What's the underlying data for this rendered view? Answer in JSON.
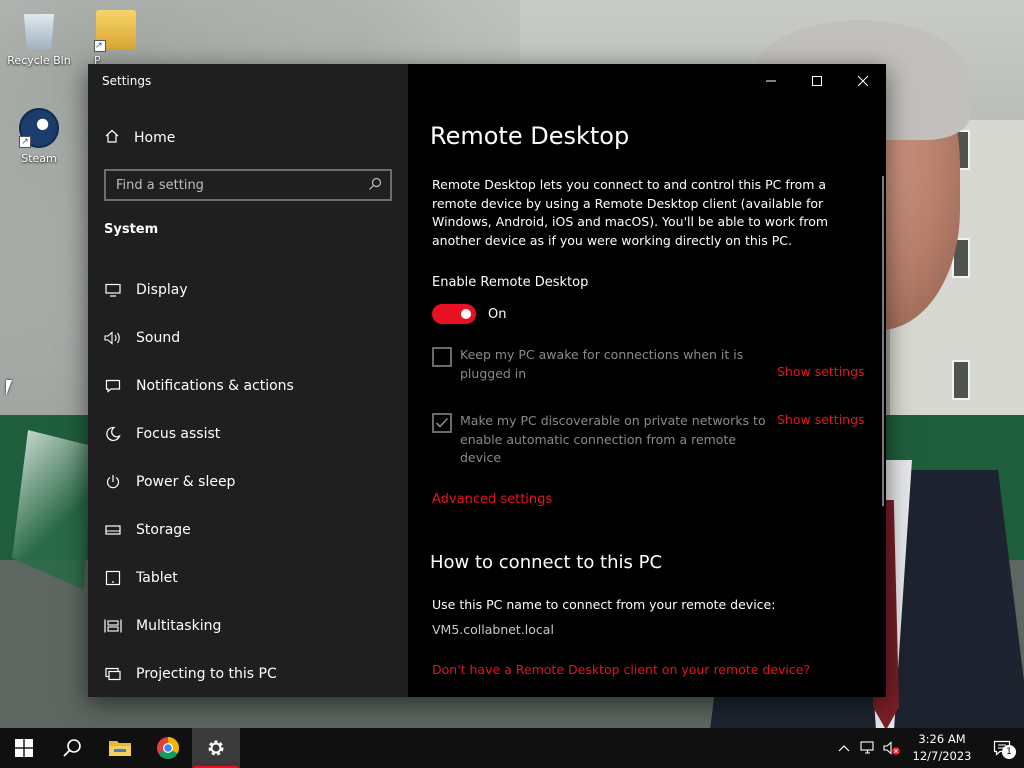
{
  "desktop": {
    "icons": [
      {
        "label": "Recycle Bin"
      },
      {
        "label": "P"
      },
      {
        "label": "Steam"
      }
    ]
  },
  "window": {
    "title": "Settings"
  },
  "sidebar": {
    "home_label": "Home",
    "search_placeholder": "Find a setting",
    "section_title": "System",
    "items": [
      {
        "label": "Display",
        "icon": "display-icon"
      },
      {
        "label": "Sound",
        "icon": "sound-icon"
      },
      {
        "label": "Notifications & actions",
        "icon": "notifications-icon"
      },
      {
        "label": "Focus assist",
        "icon": "moon-icon"
      },
      {
        "label": "Power & sleep",
        "icon": "power-icon"
      },
      {
        "label": "Storage",
        "icon": "storage-icon"
      },
      {
        "label": "Tablet",
        "icon": "tablet-icon"
      },
      {
        "label": "Multitasking",
        "icon": "multitasking-icon"
      },
      {
        "label": "Projecting to this PC",
        "icon": "projecting-icon"
      }
    ]
  },
  "content": {
    "title": "Remote Desktop",
    "description": "Remote Desktop lets you connect to and control this PC from a remote device by using a Remote Desktop client (available for Windows, Android, iOS and macOS). You'll be able to work from another device as if you were working directly on this PC.",
    "enable_label": "Enable Remote Desktop",
    "toggle_state": "On",
    "options": [
      {
        "text": "Keep my PC awake for connections when it is plugged in",
        "checked": false,
        "link": "Show settings"
      },
      {
        "text": "Make my PC discoverable on private networks to enable automatic connection from a remote device",
        "checked": true,
        "link": "Show settings"
      }
    ],
    "advanced_link": "Advanced settings",
    "how_to_title": "How to connect to this PC",
    "use_name_text": "Use this PC name to connect from your remote device:",
    "pc_name": "VM5.collabnet.local",
    "client_link": "Don't have a Remote Desktop client on your remote device?"
  },
  "taskbar": {
    "time": "3:26 AM",
    "date": "12/7/2023",
    "notification_count": "1"
  },
  "colors": {
    "accent": "#e81123",
    "sidebar_bg": "#1f1f1f",
    "content_bg": "#000000",
    "taskbar_bg": "#101010"
  }
}
